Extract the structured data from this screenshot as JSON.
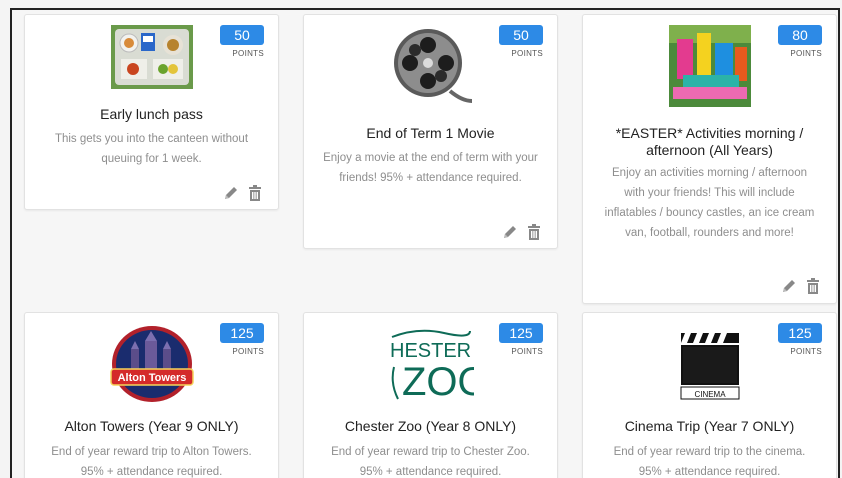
{
  "rewards": [
    {
      "points": "50",
      "points_label": "POINTS",
      "title": "Early lunch pass",
      "description": "This gets you into the canteen without queuing for 1 week.",
      "image": "lunch-tray-image"
    },
    {
      "points": "50",
      "points_label": "POINTS",
      "title": "End of Term 1 Movie",
      "description": "Enjoy a movie at the end of term with your friends! 95% + attendance required.",
      "image": "film-reel-image"
    },
    {
      "points": "80",
      "points_label": "POINTS",
      "title": "*EASTER* Activities morning / afternoon (All Years)",
      "description": "Enjoy an activities morning / afternoon with your friends! This will include inflatables / bouncy castles, an ice cream van, football, rounders and more!",
      "image": "inflatables-image"
    },
    {
      "points": "125",
      "points_label": "POINTS",
      "title": "Alton Towers (Year 9 ONLY)",
      "description": "End of year reward trip to Alton Towers. 95% + attendance required.",
      "image": "alton-towers-logo",
      "logo_text": "Alton Towers"
    },
    {
      "points": "125",
      "points_label": "POINTS",
      "title": "Chester Zoo (Year 8 ONLY)",
      "description": "End of year reward trip to Chester Zoo. 95% + attendance required.",
      "image": "chester-zoo-logo",
      "logo_text": "HESTER ZOO"
    },
    {
      "points": "125",
      "points_label": "POINTS",
      "title": "Cinema Trip (Year 7 ONLY)",
      "description": "End of year reward trip to the cinema. 95% + attendance required.",
      "image": "clapperboard-image",
      "logo_text": "CINEMA"
    }
  ],
  "icons": {
    "edit": "pencil-icon",
    "delete": "trash-icon"
  },
  "colors": {
    "badge": "#2d8ae6",
    "description": "#8e8e8e",
    "title": "#222222"
  }
}
